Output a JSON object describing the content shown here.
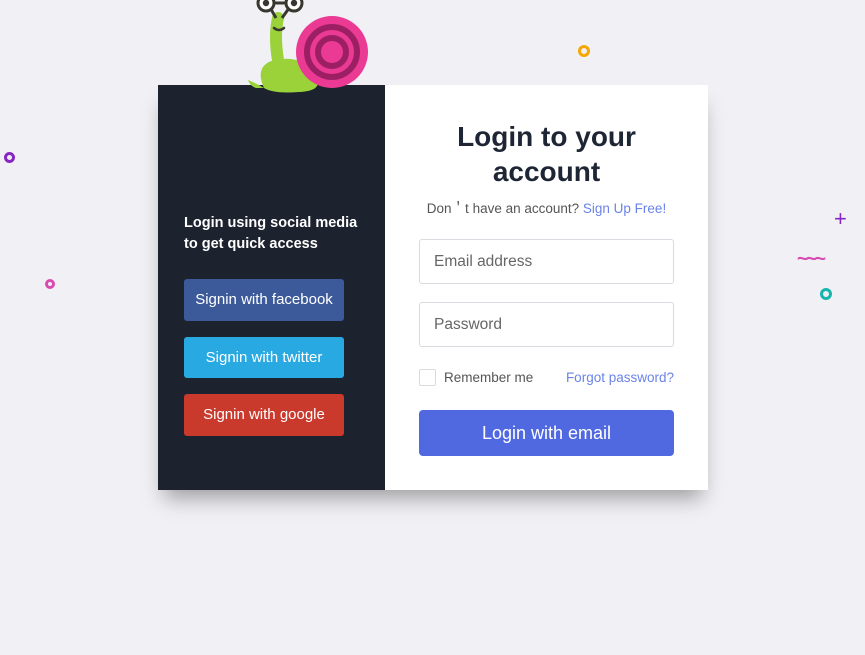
{
  "left": {
    "title": "Login using social media to get quick access",
    "facebook_label": "Signin with facebook",
    "twitter_label": "Signin with twitter",
    "google_label": "Signin with google"
  },
  "right": {
    "heading": "Login to your account",
    "sub_prefix": "Don＇t have an account? ",
    "signup_label": "Sign Up Free!",
    "email_placeholder": "Email address",
    "password_placeholder": "Password",
    "remember_label": "Remember me",
    "forgot_label": "Forgot password?",
    "login_label": "Login with email"
  },
  "colors": {
    "primary": "#5068e0",
    "facebook": "#3c5a99",
    "twitter": "#29a9e1",
    "google": "#c9392c"
  }
}
